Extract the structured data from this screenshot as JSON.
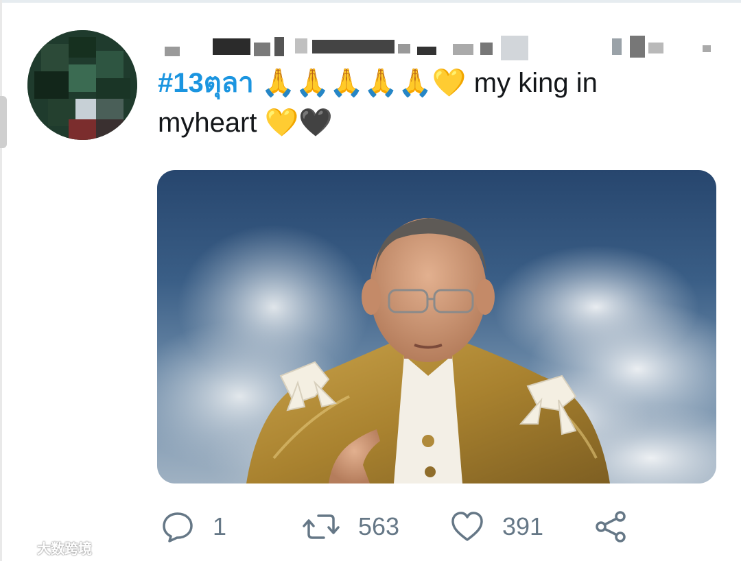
{
  "tweet": {
    "hashtag": "#13ตุลา",
    "text_part1": " my king in",
    "text_part2": "myheart ",
    "emoji_pray": "🙏🙏🙏🙏🙏",
    "emoji_heart_yellow": "💛",
    "emoji_heart_black": "🖤"
  },
  "actions": {
    "reply_count": "1",
    "retweet_count": "563",
    "like_count": "391"
  },
  "watermark": {
    "text": "大数跨境"
  },
  "icons": {
    "reply": "reply-icon",
    "retweet": "retweet-icon",
    "like": "heart-icon",
    "share": "share-icon"
  },
  "colors": {
    "hashtag": "#1b95e0",
    "action_gray": "#657786",
    "text": "#14171a"
  }
}
